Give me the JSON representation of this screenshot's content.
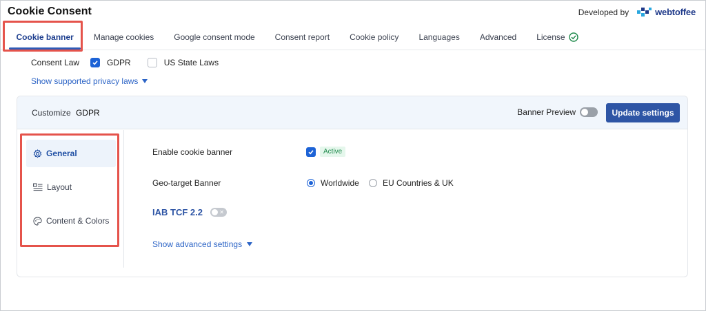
{
  "header": {
    "title": "Cookie Consent",
    "developed_by_label": "Developed by",
    "brand_name": "webtoffee"
  },
  "tabs": [
    {
      "label": "Cookie banner",
      "active": true
    },
    {
      "label": "Manage cookies",
      "active": false
    },
    {
      "label": "Google consent mode",
      "active": false
    },
    {
      "label": "Consent report",
      "active": false
    },
    {
      "label": "Cookie policy",
      "active": false
    },
    {
      "label": "Languages",
      "active": false
    },
    {
      "label": "Advanced",
      "active": false
    },
    {
      "label": "License",
      "active": false
    }
  ],
  "consent_law": {
    "label": "Consent Law",
    "options": [
      {
        "label": "GDPR",
        "checked": true
      },
      {
        "label": "US State Laws",
        "checked": false
      }
    ],
    "show_laws_link": "Show supported privacy laws"
  },
  "customize": {
    "label": "Customize",
    "value": "GDPR",
    "banner_preview_label": "Banner Preview",
    "banner_preview_on": false,
    "update_button": "Update settings"
  },
  "sidenav": {
    "items": [
      {
        "label": "General",
        "icon": "gear-icon",
        "active": true
      },
      {
        "label": "Layout",
        "icon": "layout-icon",
        "active": false
      },
      {
        "label": "Content & Colors",
        "icon": "palette-icon",
        "active": false
      }
    ]
  },
  "settings": {
    "enable_banner_label": "Enable cookie banner",
    "enable_banner_checked": true,
    "active_badge": "Active",
    "geo_label": "Geo-target Banner",
    "geo_options": [
      {
        "label": "Worldwide",
        "selected": true
      },
      {
        "label": "EU Countries & UK",
        "selected": false
      }
    ],
    "iab_label": "IAB TCF 2.2",
    "iab_on": false,
    "show_advanced": "Show advanced settings"
  },
  "colors": {
    "accent": "#2e55a5",
    "link": "#2c64c6",
    "highlight": "#e5534b",
    "success": "#1f8a4c"
  }
}
